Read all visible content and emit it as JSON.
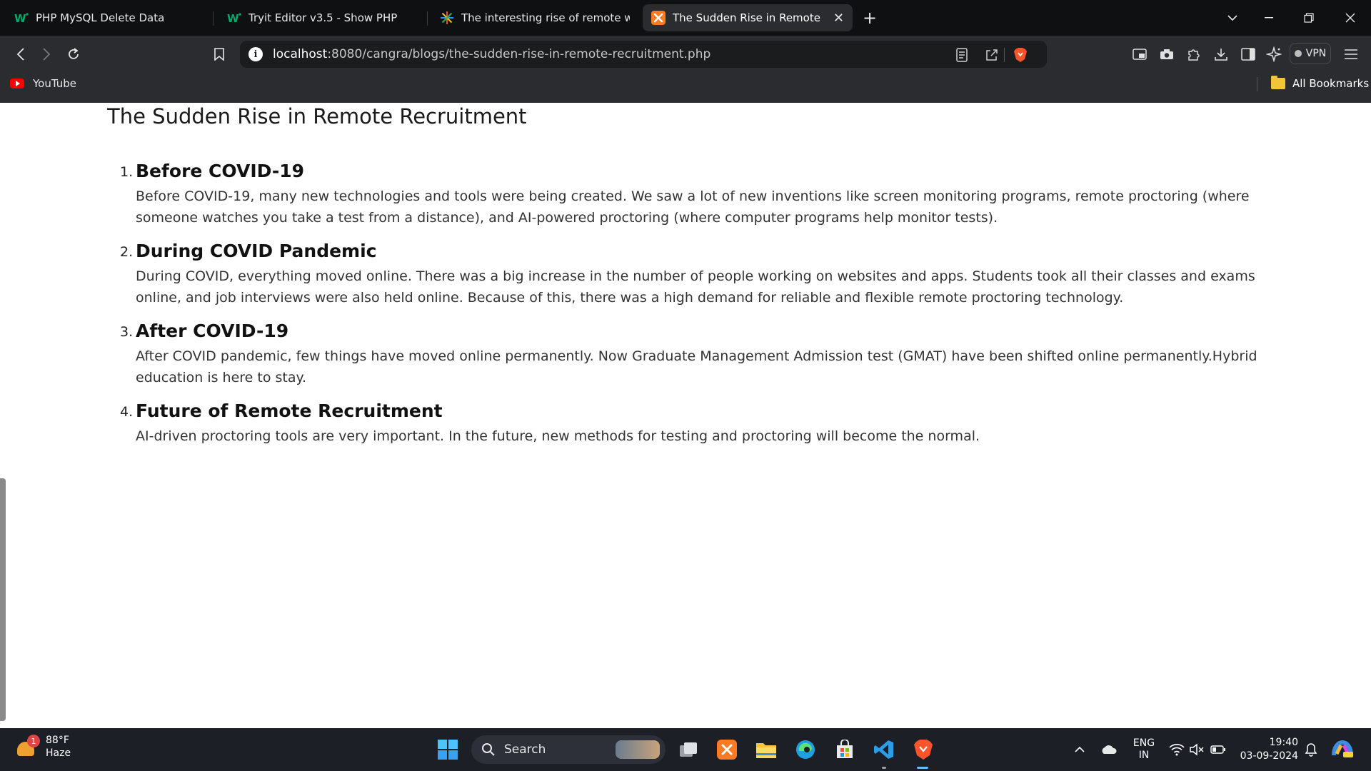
{
  "browser": {
    "tabs": [
      {
        "title": "PHP MySQL Delete Data",
        "icon": "w3schools-icon",
        "active": false
      },
      {
        "title": "Tryit Editor v3.5 - Show PHP",
        "icon": "w3schools-icon",
        "active": false
      },
      {
        "title": "The interesting rise of remote work",
        "icon": "pinwheel-icon",
        "active": false
      },
      {
        "title": "The Sudden Rise in Remote Rec",
        "icon": "xampp-icon",
        "active": true
      }
    ],
    "new_tab": "+",
    "address": {
      "host": "localhost",
      "rest": ":8080/cangra/blogs/the-sudden-rise-in-remote-recruitment.php"
    },
    "vpn_label": "VPN",
    "bookmarks": {
      "youtube": "YouTube",
      "all": "All Bookmarks"
    }
  },
  "page": {
    "title": "The Sudden Rise in Remote Recruitment",
    "sections": [
      {
        "num": "1.",
        "heading": "Before COVID-19",
        "text": "Before COVID-19, many new technologies and tools were being created. We saw a lot of new inventions like screen monitoring programs, remote proctoring (where someone watches you take a test from a distance), and AI-powered proctoring (where computer programs help monitor tests)."
      },
      {
        "num": "2.",
        "heading": "During COVID Pandemic",
        "text": "During COVID, everything moved online. There was a big increase in the number of people working on websites and apps. Students took all their classes and exams online, and job interviews were also held online. Because of this, there was a high demand for reliable and flexible remote proctoring technology."
      },
      {
        "num": "3.",
        "heading": "After COVID-19",
        "text": "After COVID pandemic, few things have moved online permanently. Now Graduate Management Admission test (GMAT) have been shifted online permanently.Hybrid education is here to stay."
      },
      {
        "num": "4.",
        "heading": "Future of Remote Recruitment",
        "text": "AI-driven proctoring tools are very important. In the future, new methods for testing and proctoring will become the normal."
      }
    ]
  },
  "taskbar": {
    "weather": {
      "temp": "88°F",
      "condition": "Haze",
      "badge": "1"
    },
    "search_placeholder": "Search",
    "lang": {
      "top": "ENG",
      "bottom": "IN"
    },
    "time": "19:40",
    "date": "03-09-2024"
  },
  "colors": {
    "tabstrip": "#0f1011",
    "toolbar": "#2b2c2f",
    "taskbar": "#1c1f26",
    "brave_orange": "#fb542b"
  }
}
